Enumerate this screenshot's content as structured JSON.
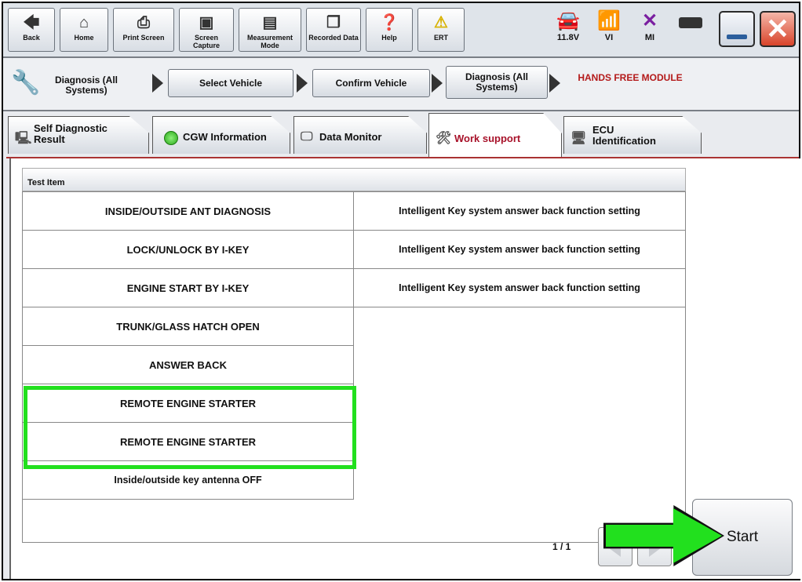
{
  "toolbar": {
    "buttons": [
      {
        "label": "Back",
        "icon": "back-arrow-icon"
      },
      {
        "label": "Home",
        "icon": "home-icon"
      },
      {
        "label": "Print Screen",
        "icon": "printer-icon"
      },
      {
        "label": "Screen Capture",
        "icon": "camera-icon"
      },
      {
        "label": "Measurement Mode",
        "icon": "meter-icon"
      },
      {
        "label": "Recorded Data",
        "icon": "recorded-data-icon"
      },
      {
        "label": "Help",
        "icon": "help-icon"
      },
      {
        "label": "ERT",
        "icon": "warning-icon"
      }
    ],
    "status": [
      {
        "label": "11.8V",
        "icon": "car-battery-icon"
      },
      {
        "label": "VI",
        "icon": "signal-icon"
      },
      {
        "label": "MI",
        "icon": "cross-icon"
      },
      {
        "label": "",
        "icon": "battery-icon"
      }
    ]
  },
  "breadcrumb": {
    "first": "Diagnosis (All Systems)",
    "steps": [
      "Select Vehicle",
      "Confirm Vehicle",
      "Diagnosis (All Systems)"
    ],
    "current": "HANDS FREE MODULE"
  },
  "tabs": [
    {
      "label": "Self Diagnostic Result"
    },
    {
      "label": "CGW Information"
    },
    {
      "label": "Data Monitor"
    },
    {
      "label": "Work support"
    },
    {
      "label": "ECU Identification"
    }
  ],
  "test_table": {
    "header": "Test Item",
    "left": [
      "INSIDE/OUTSIDE ANT DIAGNOSIS",
      "LOCK/UNLOCK BY I-KEY",
      "ENGINE START BY I-KEY",
      "TRUNK/GLASS HATCH OPEN",
      "ANSWER BACK",
      "REMOTE ENGINE STARTER",
      "REMOTE ENGINE STARTER",
      "Inside/outside key antenna OFF"
    ],
    "right": [
      "Intelligent Key system answer back function setting",
      "Intelligent Key system answer back function setting",
      "Intelligent Key system answer back function setting"
    ]
  },
  "pager": "1 / 1",
  "start_label": "Start",
  "colors": {
    "highlight": "#22e01e",
    "active_tab_text": "#a8122a",
    "current_module": "#b41a1a"
  }
}
